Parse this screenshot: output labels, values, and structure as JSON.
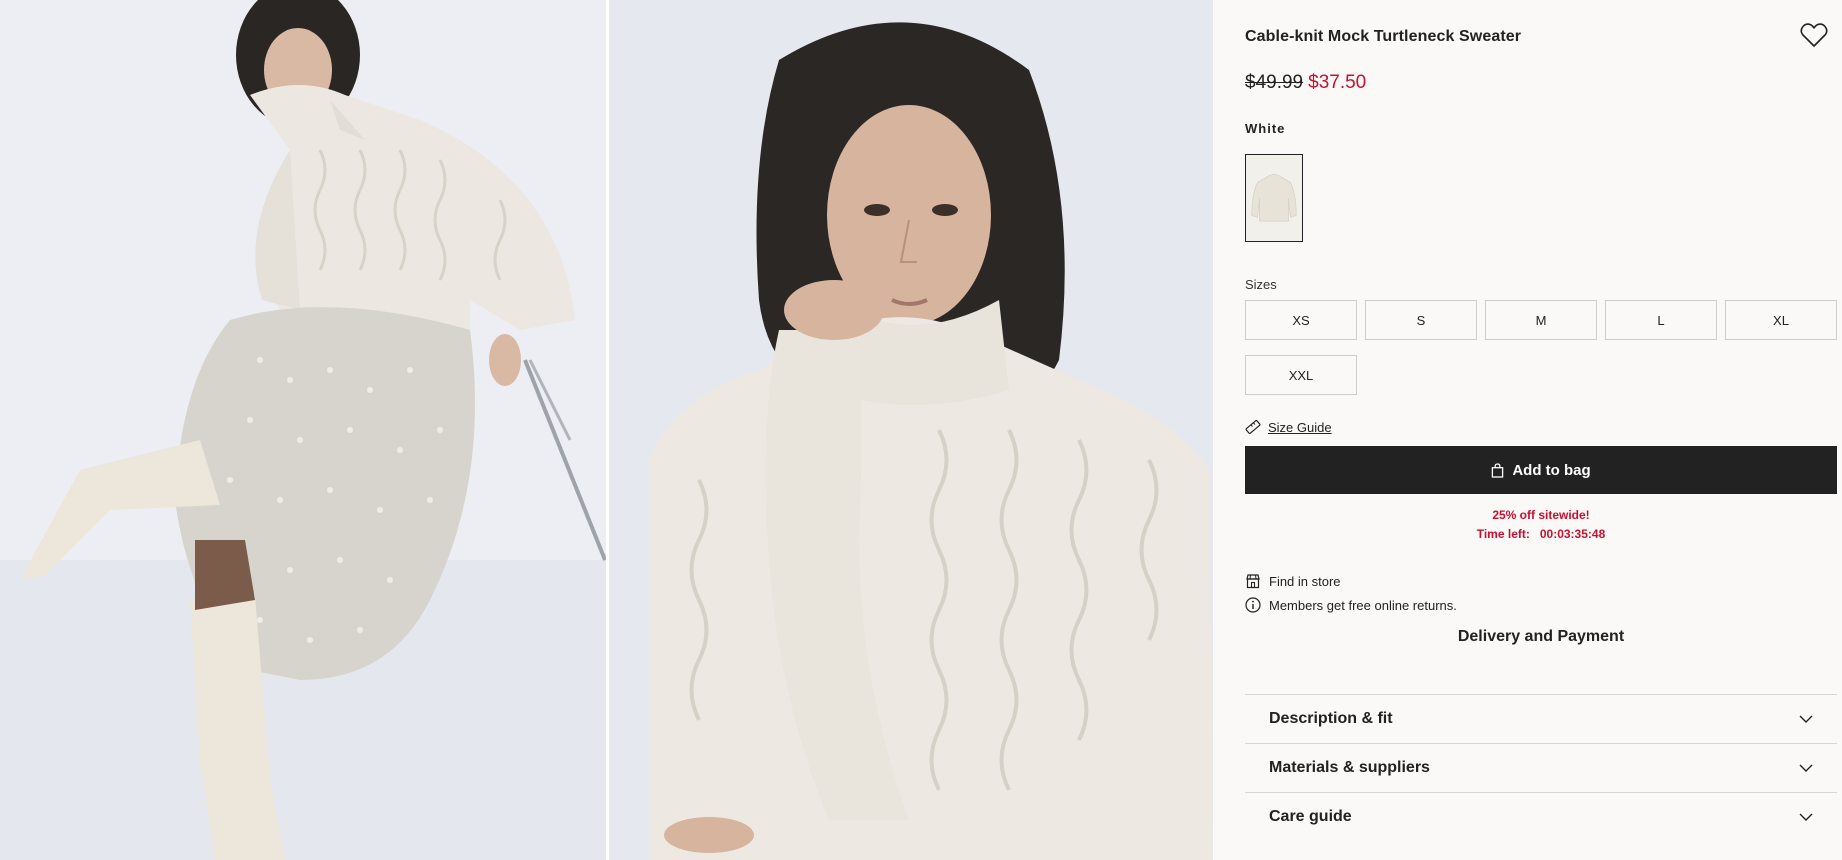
{
  "product": {
    "title": "Cable-knit Mock Turtleneck Sweater",
    "price_original": "$49.99",
    "price_sale": "$37.50",
    "color_name": "White"
  },
  "sizes": {
    "label": "Sizes",
    "options": [
      "XS",
      "S",
      "M",
      "L",
      "XL",
      "XXL"
    ]
  },
  "size_guide": {
    "label": "Size Guide"
  },
  "add_to_bag": {
    "label": "Add to bag"
  },
  "promo": {
    "line1": "25% off sitewide!",
    "line2": "Time left:   00:03:35:48"
  },
  "info": {
    "find_in_store": "Find in store",
    "free_returns": "Members get free online returns."
  },
  "delivery": {
    "label": "Delivery and Payment"
  },
  "accordions": [
    "Description & fit",
    "Materials & suppliers",
    "Care guide"
  ],
  "icons": [
    "heart-icon",
    "ruler-icon",
    "bag-icon",
    "store-icon",
    "info-icon",
    "chevron-down-icon"
  ],
  "colors": {
    "sale": "#c8102e",
    "button": "#222222",
    "panel_bg": "#faf9f8"
  }
}
